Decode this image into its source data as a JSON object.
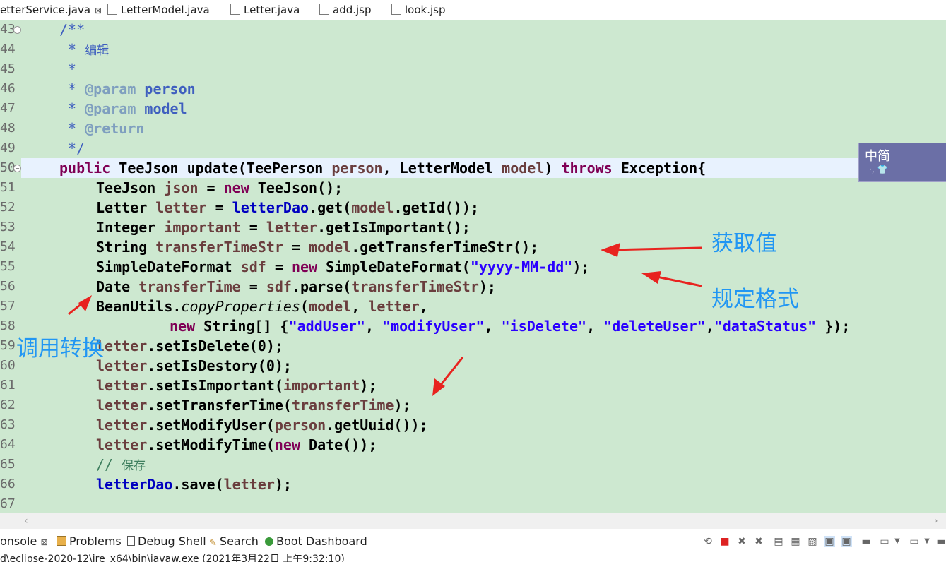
{
  "tabs": [
    {
      "label": "etterService.java",
      "close": "⊠"
    },
    {
      "label": "LetterModel.java"
    },
    {
      "label": "Letter.java"
    },
    {
      "label": "add.jsp"
    },
    {
      "label": "look.jsp"
    }
  ],
  "line_numbers": [
    "43",
    "44",
    "45",
    "46",
    "47",
    "48",
    "49",
    "50",
    "51",
    "52",
    "53",
    "54",
    "55",
    "56",
    "57",
    "58",
    "59",
    "60",
    "61",
    "62",
    "63",
    "64",
    "65",
    "66",
    "67"
  ],
  "code": {
    "l43": "/**",
    "l44_star": " * ",
    "l44_text": "编辑",
    "l45": " *",
    "l46_star": " * ",
    "l46_tag": "@param",
    "l46_name": " person",
    "l47_star": " * ",
    "l47_tag": "@param",
    "l47_name": " model",
    "l48_star": " * ",
    "l48_tag": "@return",
    "l49": " */",
    "l50_public": "public",
    "l50_a": " TeeJson update(TeePerson ",
    "l50_person": "person",
    "l50_b": ", LetterModel ",
    "l50_model": "model",
    "l50_c": ") ",
    "l50_throws": "throws",
    "l50_d": " Exception{",
    "l51_a": "TeeJson ",
    "l51_json": "json",
    "l51_b": " = ",
    "l51_new": "new",
    "l51_c": " TeeJson();",
    "l52_a": "Letter ",
    "l52_letter": "letter",
    "l52_b": " = ",
    "l52_dao": "letterDao",
    "l52_c": ".get(",
    "l52_model": "model",
    "l52_d": ".getId());",
    "l53_a": "Integer ",
    "l53_imp": "important",
    "l53_b": " = ",
    "l53_letter": "letter",
    "l53_c": ".getIsImportant();",
    "l54_a": "String ",
    "l54_tts": "transferTimeStr",
    "l54_b": " = ",
    "l54_model": "model",
    "l54_c": ".getTransferTimeStr();",
    "l55_a": "SimpleDateFormat ",
    "l55_sdf": "sdf",
    "l55_b": " = ",
    "l55_new": "new",
    "l55_c": " SimpleDateFormat(",
    "l55_str": "\"yyyy-MM-dd\"",
    "l55_d": ");",
    "l56_a": "Date ",
    "l56_tt": "transferTime",
    "l56_b": " = ",
    "l56_sdf": "sdf",
    "l56_c": ".parse(",
    "l56_tts": "transferTimeStr",
    "l56_d": ");",
    "l57_a": "BeanUtils.",
    "l57_cp": "copyProperties",
    "l57_b": "(",
    "l57_model": "model",
    "l57_c": ", ",
    "l57_letter": "letter",
    "l57_d": ",",
    "l58_new": "new",
    "l58_a": " String[] {",
    "l58_s1": "\"addUser\"",
    "l58_c1": ", ",
    "l58_s2": "\"modifyUser\"",
    "l58_c2": ", ",
    "l58_s3": "\"isDelete\"",
    "l58_c3": ", ",
    "l58_s4": "\"deleteUser\"",
    "l58_c4": ",",
    "l58_s5": "\"dataStatus\"",
    "l58_e": " });",
    "l59_letter": "letter",
    "l59_a": ".setIsDelete(0);",
    "l60_letter": "letter",
    "l60_a": ".setIsDestory(0);",
    "l61_letter": "letter",
    "l61_a": ".setIsImportant(",
    "l61_imp": "important",
    "l61_b": ");",
    "l62_letter": "letter",
    "l62_a": ".setTransferTime(",
    "l62_tt": "transferTime",
    "l62_b": ");",
    "l63_letter": "letter",
    "l63_a": ".setModifyUser(",
    "l63_person": "person",
    "l63_b": ".getUuid());",
    "l64_letter": "letter",
    "l64_a": ".setModifyTime(",
    "l64_new": "new",
    "l64_b": " Date());",
    "l65_slash": "// ",
    "l65_text": "保存",
    "l66_dao": "letterDao",
    "l66_a": ".save(",
    "l66_letter": "letter",
    "l66_b": ");"
  },
  "annotations": {
    "get_value": "获取值",
    "format": "规定格式",
    "call_convert": "调用转换",
    "arrow_color": "#e8231f",
    "text_color": "#2196f3"
  },
  "ime": {
    "text": "中简",
    "dots": "·, 👕"
  },
  "console_tabs": [
    {
      "label": "onsole",
      "close": "⊠"
    },
    {
      "label": "Problems"
    },
    {
      "label": "Debug Shell"
    },
    {
      "label": "Search"
    },
    {
      "label": "Boot Dashboard"
    }
  ],
  "status_line": "d\\eclipse-2020-12\\jre_x64\\bin\\javaw.exe (2021年3月22日 上午9:32:10)",
  "colors": {
    "editor_bg": "#cde8d0",
    "keyword": "#7f0055",
    "field": "#0000c0",
    "string": "#2a00ff",
    "variable": "#6a3e3e",
    "javadoc": "#3f5fbf",
    "comment": "#3f7f5f"
  }
}
